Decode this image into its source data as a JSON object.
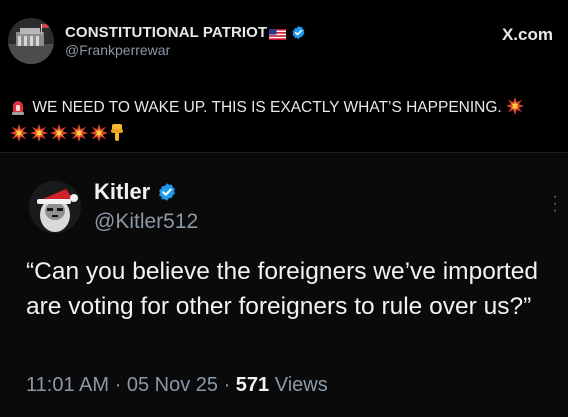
{
  "post": {
    "author_name": "CONSTITUTIONAL PATRIOT",
    "author_handle": "@Frankperrewar",
    "site_label": "X.com",
    "text": "WE NEED TO WAKE UP. THIS IS EXACTLY WHAT’S HAPPENING.",
    "emojis": [
      "siren-icon",
      "collision-icon",
      "collision-icon",
      "collision-icon",
      "collision-icon",
      "collision-icon",
      "collision-icon",
      "pointing-down-icon"
    ]
  },
  "quote": {
    "author_name": "Kitler",
    "author_handle": "@Kitler512",
    "text": "“Can you believe the foreigners we’ve imported are voting for other foreigners to rule over us?”",
    "time": "11:01 AM",
    "separator": "·",
    "date": "05 Nov 25",
    "views_count": "571",
    "views_label": "Views"
  },
  "colors": {
    "background": "#000000",
    "text": "#e7e9ea",
    "secondary_text": "#8b98a5",
    "verified_blue": "#1d9bf0"
  }
}
